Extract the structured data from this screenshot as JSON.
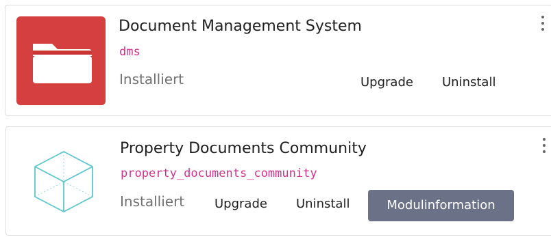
{
  "modules": [
    {
      "title": "Document Management System",
      "technical_name": "dms",
      "status": "Installiert",
      "icon": "folder-icon",
      "icon_bg": "#d63f3f",
      "actions": {
        "upgrade": "Upgrade",
        "uninstall": "Uninstall"
      }
    },
    {
      "title": "Property Documents Community",
      "technical_name": "property_documents_community",
      "status": "Installiert",
      "icon": "cube-icon",
      "icon_color": "#5ec7cc",
      "actions": {
        "upgrade": "Upgrade",
        "uninstall": "Uninstall",
        "info": "Modulinformation"
      }
    }
  ],
  "colors": {
    "technical_name": "#d2318a",
    "info_button_bg": "#6b7288"
  }
}
